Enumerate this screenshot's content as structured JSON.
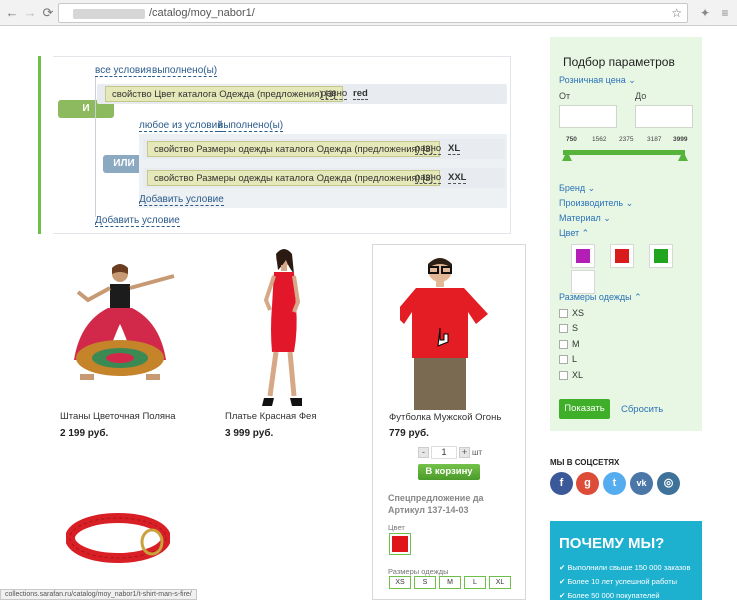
{
  "browser": {
    "url": "/catalog/moy_nabor1/",
    "status_url": "collections.sarafan.ru/catalog/moy_nabor1/t-shirt-man-s-fire/"
  },
  "condition_editor": {
    "top_links": [
      "все условия",
      "выполнено(ы)"
    ],
    "and_badge": "И",
    "row1": {
      "property": "свойство Цвет каталога Одежда (предложения) [3]",
      "op": "равно",
      "value": "red"
    },
    "group_links": [
      "любое из условий",
      "выполнено(ы)"
    ],
    "or_badge": "ИЛИ",
    "row2": {
      "property": "свойство Размеры одежды каталога Одежда (предложения) [3]",
      "op": "равно",
      "value": "XL"
    },
    "row3": {
      "property": "свойство Размеры одежды каталога Одежда (предложения) [3]",
      "op": "равно",
      "value": "XXL"
    },
    "add_inner": "Добавить условие",
    "add_outer": "Добавить условие",
    "colors": {
      "and": "#8dba5e",
      "or": "#8ca9c2"
    }
  },
  "products": [
    {
      "name": "Штаны Цветочная Поляна",
      "price": "2 199 руб."
    },
    {
      "name": "Платье Красная Фея",
      "price": "3 999 руб."
    },
    {
      "name": "Футболка Мужской Огонь",
      "price": "779 руб."
    }
  ],
  "card": {
    "qty_minus": "-",
    "qty": "1",
    "qty_plus": "+",
    "qty_unit": "шт",
    "cart_label": "В корзину",
    "spec_title": "Спецпредложение да",
    "article": "Артикул 137-14-03",
    "color_label": "Цвет",
    "sizes_label": "Размеры одежды",
    "sizes": [
      "XS",
      "S",
      "M",
      "L",
      "XL"
    ]
  },
  "filter": {
    "title": "Подбор параметров",
    "price_section": "Розничная цена",
    "from_label": "От",
    "to_label": "До",
    "slider_ticks": [
      "750",
      "1562",
      "2375",
      "3187",
      "3999"
    ],
    "sections": [
      "Бренд",
      "Производитель",
      "Материал",
      "Цвет"
    ],
    "swatches": [
      "#b41eb4",
      "#d81c1c",
      "#22a51e",
      "#ffffff"
    ],
    "sizes_section": "Размеры одежды",
    "sizes": [
      "XS",
      "S",
      "M",
      "L",
      "XL"
    ],
    "show_label": "Показать",
    "reset_label": "Сбросить"
  },
  "social": {
    "title": "МЫ В СОЦСЕТЯХ",
    "icons": [
      {
        "name": "facebook-icon",
        "glyph": "f",
        "color": "#3b5998"
      },
      {
        "name": "google-plus-icon",
        "glyph": "g",
        "color": "#dd4b39"
      },
      {
        "name": "twitter-icon",
        "glyph": "t",
        "color": "#55acee"
      },
      {
        "name": "vk-icon",
        "glyph": "vk",
        "color": "#4a76a8"
      },
      {
        "name": "instagram-icon",
        "glyph": "◎",
        "color": "#3f729b"
      }
    ]
  },
  "why_us": {
    "title": "ПОЧЕМУ МЫ?",
    "items": [
      "Выполнили свыше 150 000 заказов",
      "Более 10 лет успешной работы",
      "Более 50 000 покупателей"
    ]
  }
}
